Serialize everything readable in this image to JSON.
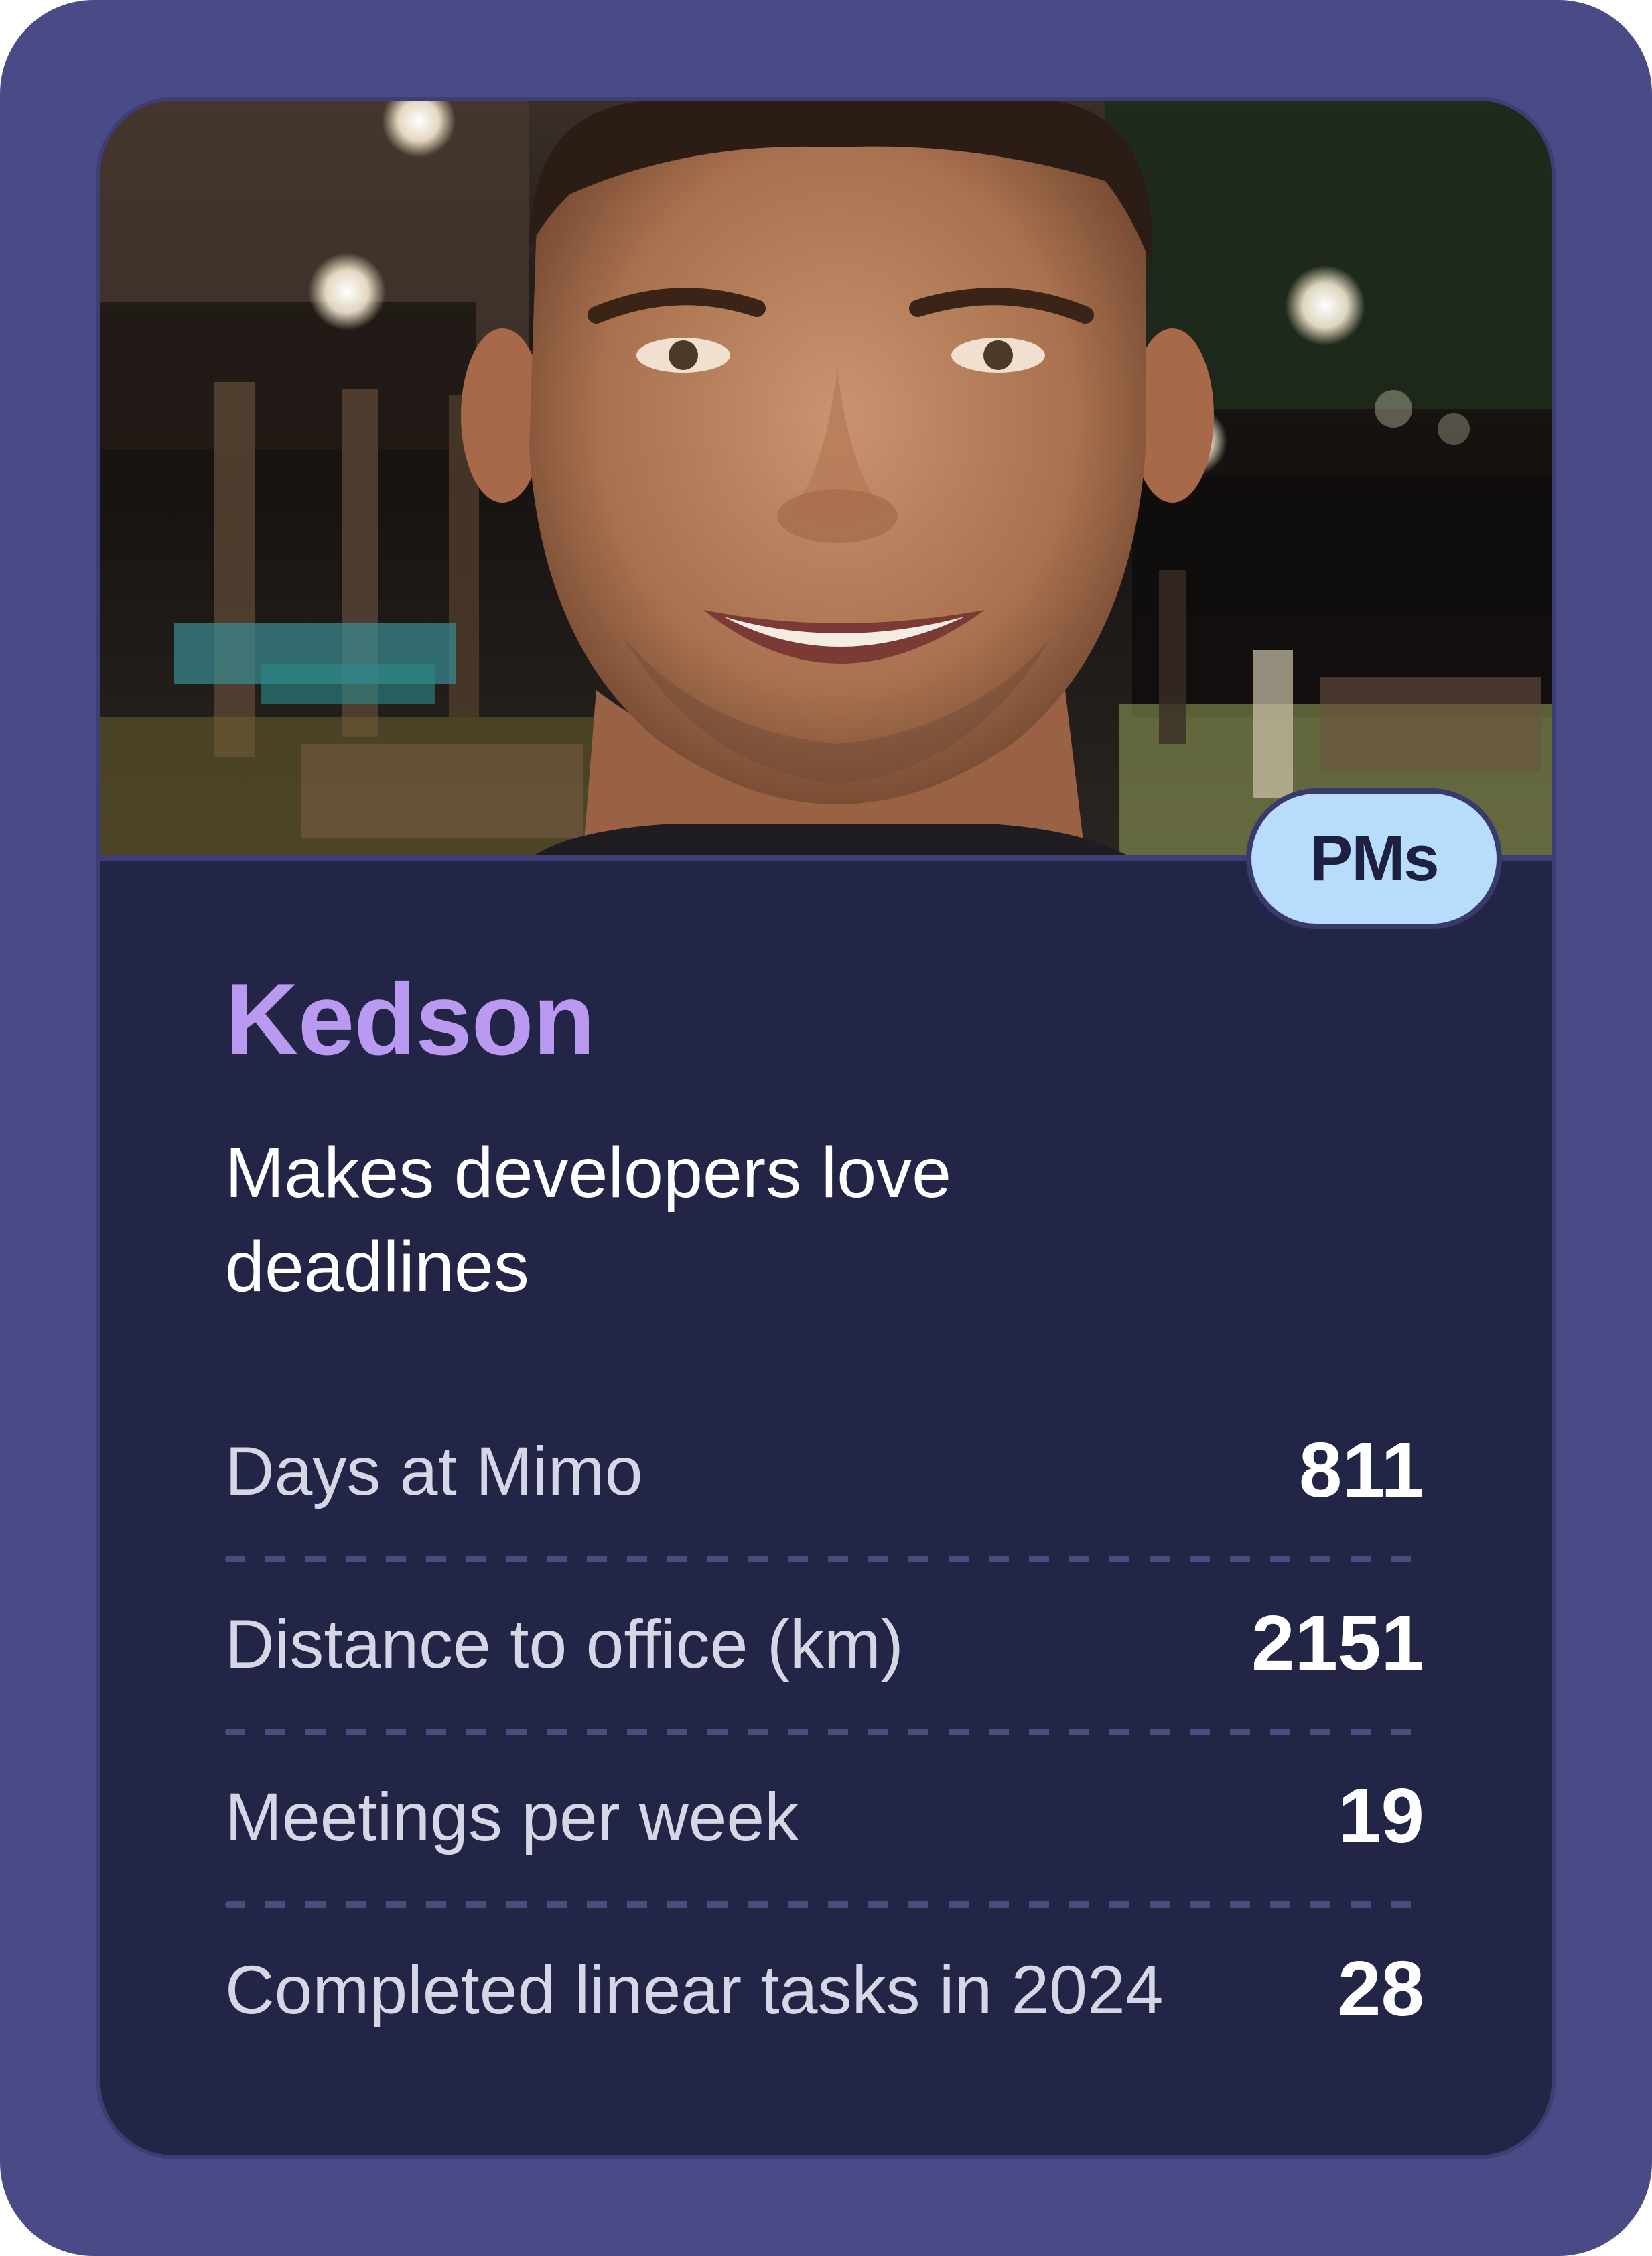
{
  "profile": {
    "name": "Kedson",
    "tagline": "Makes developers love deadlines",
    "team_badge": "PMs",
    "photo_icon": "person-photo"
  },
  "stats": [
    {
      "label": "Days at Mimo",
      "value": "811"
    },
    {
      "label": "Distance to office (km)",
      "value": "2151"
    },
    {
      "label": "Meetings per week",
      "value": "19"
    },
    {
      "label": "Completed linear tasks in 2024",
      "value": "28"
    }
  ],
  "colors": {
    "outer_background": "#4a4b86",
    "card_background": "#232546",
    "name_accent": "#b99af0",
    "badge_background": "#b8dcfb"
  }
}
